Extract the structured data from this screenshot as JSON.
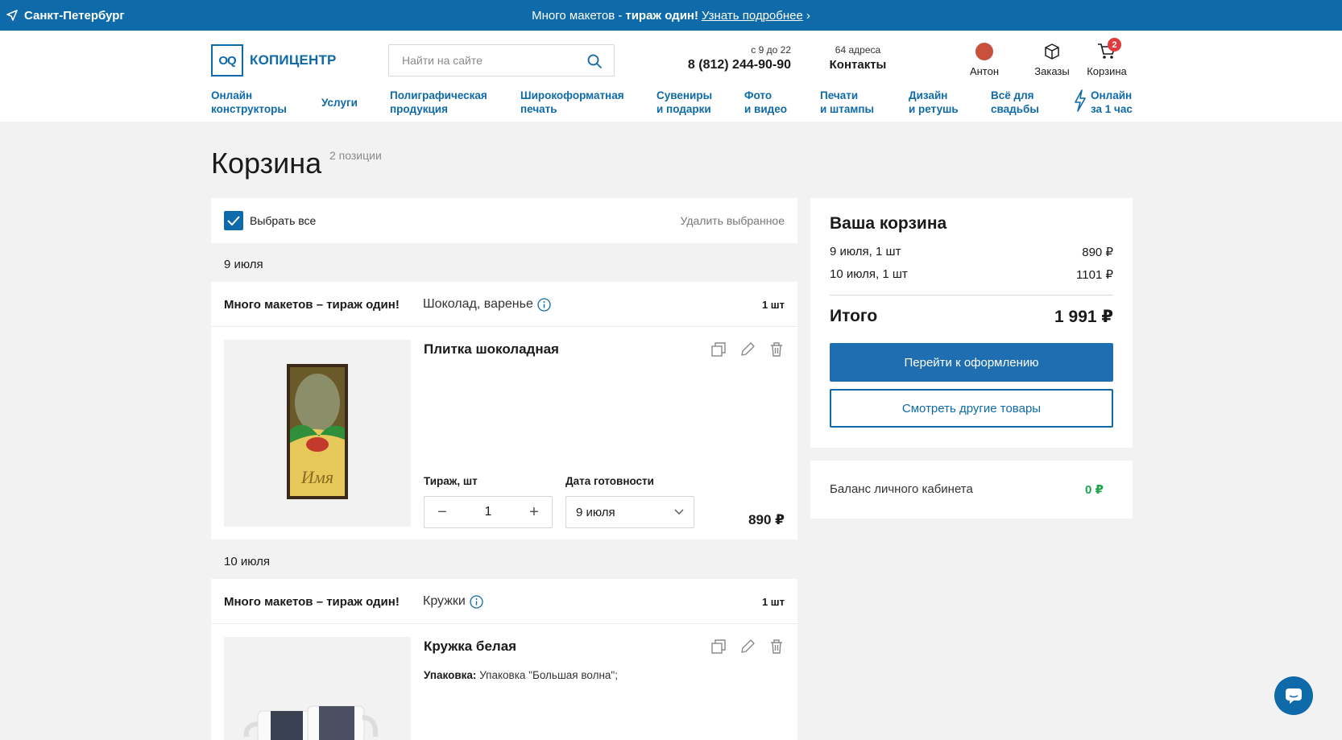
{
  "topbar": {
    "city": "Санкт-Петербург",
    "promo_text": "Много макетов -",
    "promo_bold": "тираж один!",
    "promo_link": "Узнать подробнее",
    "promo_chevron": "›"
  },
  "header": {
    "logo_mark": "OQ",
    "logo_text": "КОПИЦЕНТР",
    "search_placeholder": "Найти на сайте",
    "hours": "с 9 до 22",
    "phone": "8 (812) 244-90-90",
    "addresses": "64 адреса",
    "contacts": "Контакты",
    "user_name": "Антон",
    "orders": "Заказы",
    "cart": "Корзина",
    "cart_count": "2"
  },
  "nav": [
    {
      "line1": "Онлайн",
      "line2": "конструкторы"
    },
    {
      "line1": "Услуги",
      "line2": ""
    },
    {
      "line1": "Полиграфическая",
      "line2": "продукция"
    },
    {
      "line1": "Широкоформатная",
      "line2": "печать"
    },
    {
      "line1": "Сувениры",
      "line2": "и подарки"
    },
    {
      "line1": "Фото",
      "line2": "и видео"
    },
    {
      "line1": "Печати",
      "line2": "и штампы"
    },
    {
      "line1": "Дизайн",
      "line2": "и ретушь"
    },
    {
      "line1": "Всё для",
      "line2": "свадьбы"
    },
    {
      "line1": "Онлайн",
      "line2": "за 1 час"
    }
  ],
  "page": {
    "title": "Корзина",
    "count": "2 позиции"
  },
  "cart": {
    "select_all": "Выбрать все",
    "delete_selected": "Удалить выбранное",
    "groups": [
      {
        "date": "9 июля",
        "promo": "Много макетов – тираж один!",
        "category": "Шоколад, варенье",
        "qty_label": "1 шт",
        "product": "Плитка шоколадная",
        "thumb_text": "Имя",
        "tirazh_label": "Тираж, шт",
        "quantity": "1",
        "date_label": "Дата готовности",
        "ready_date": "9 июля",
        "price": "890 ₽"
      },
      {
        "date": "10 июля",
        "promo": "Много макетов – тираж один!",
        "category": "Кружки",
        "qty_label": "1 шт",
        "product": "Кружка белая",
        "pack_label": "Упаковка:",
        "pack_value": "Упаковка \"Большая волна\";"
      }
    ]
  },
  "summary": {
    "title": "Ваша корзина",
    "rows": [
      {
        "label": "9 июля, 1 шт",
        "value": "890 ₽"
      },
      {
        "label": "10 июля, 1 шт",
        "value": "1101 ₽"
      }
    ],
    "total_label": "Итого",
    "total_value": "1 991 ₽",
    "checkout": "Перейти к оформлению",
    "browse": "Смотреть другие товары"
  },
  "balance": {
    "label": "Баланс личного кабинета",
    "value": "0 ₽"
  },
  "colors": {
    "brand": "#0e6aa8",
    "button": "#1f6eb2",
    "badge": "#e23b3b",
    "balance": "#1fa34a"
  }
}
